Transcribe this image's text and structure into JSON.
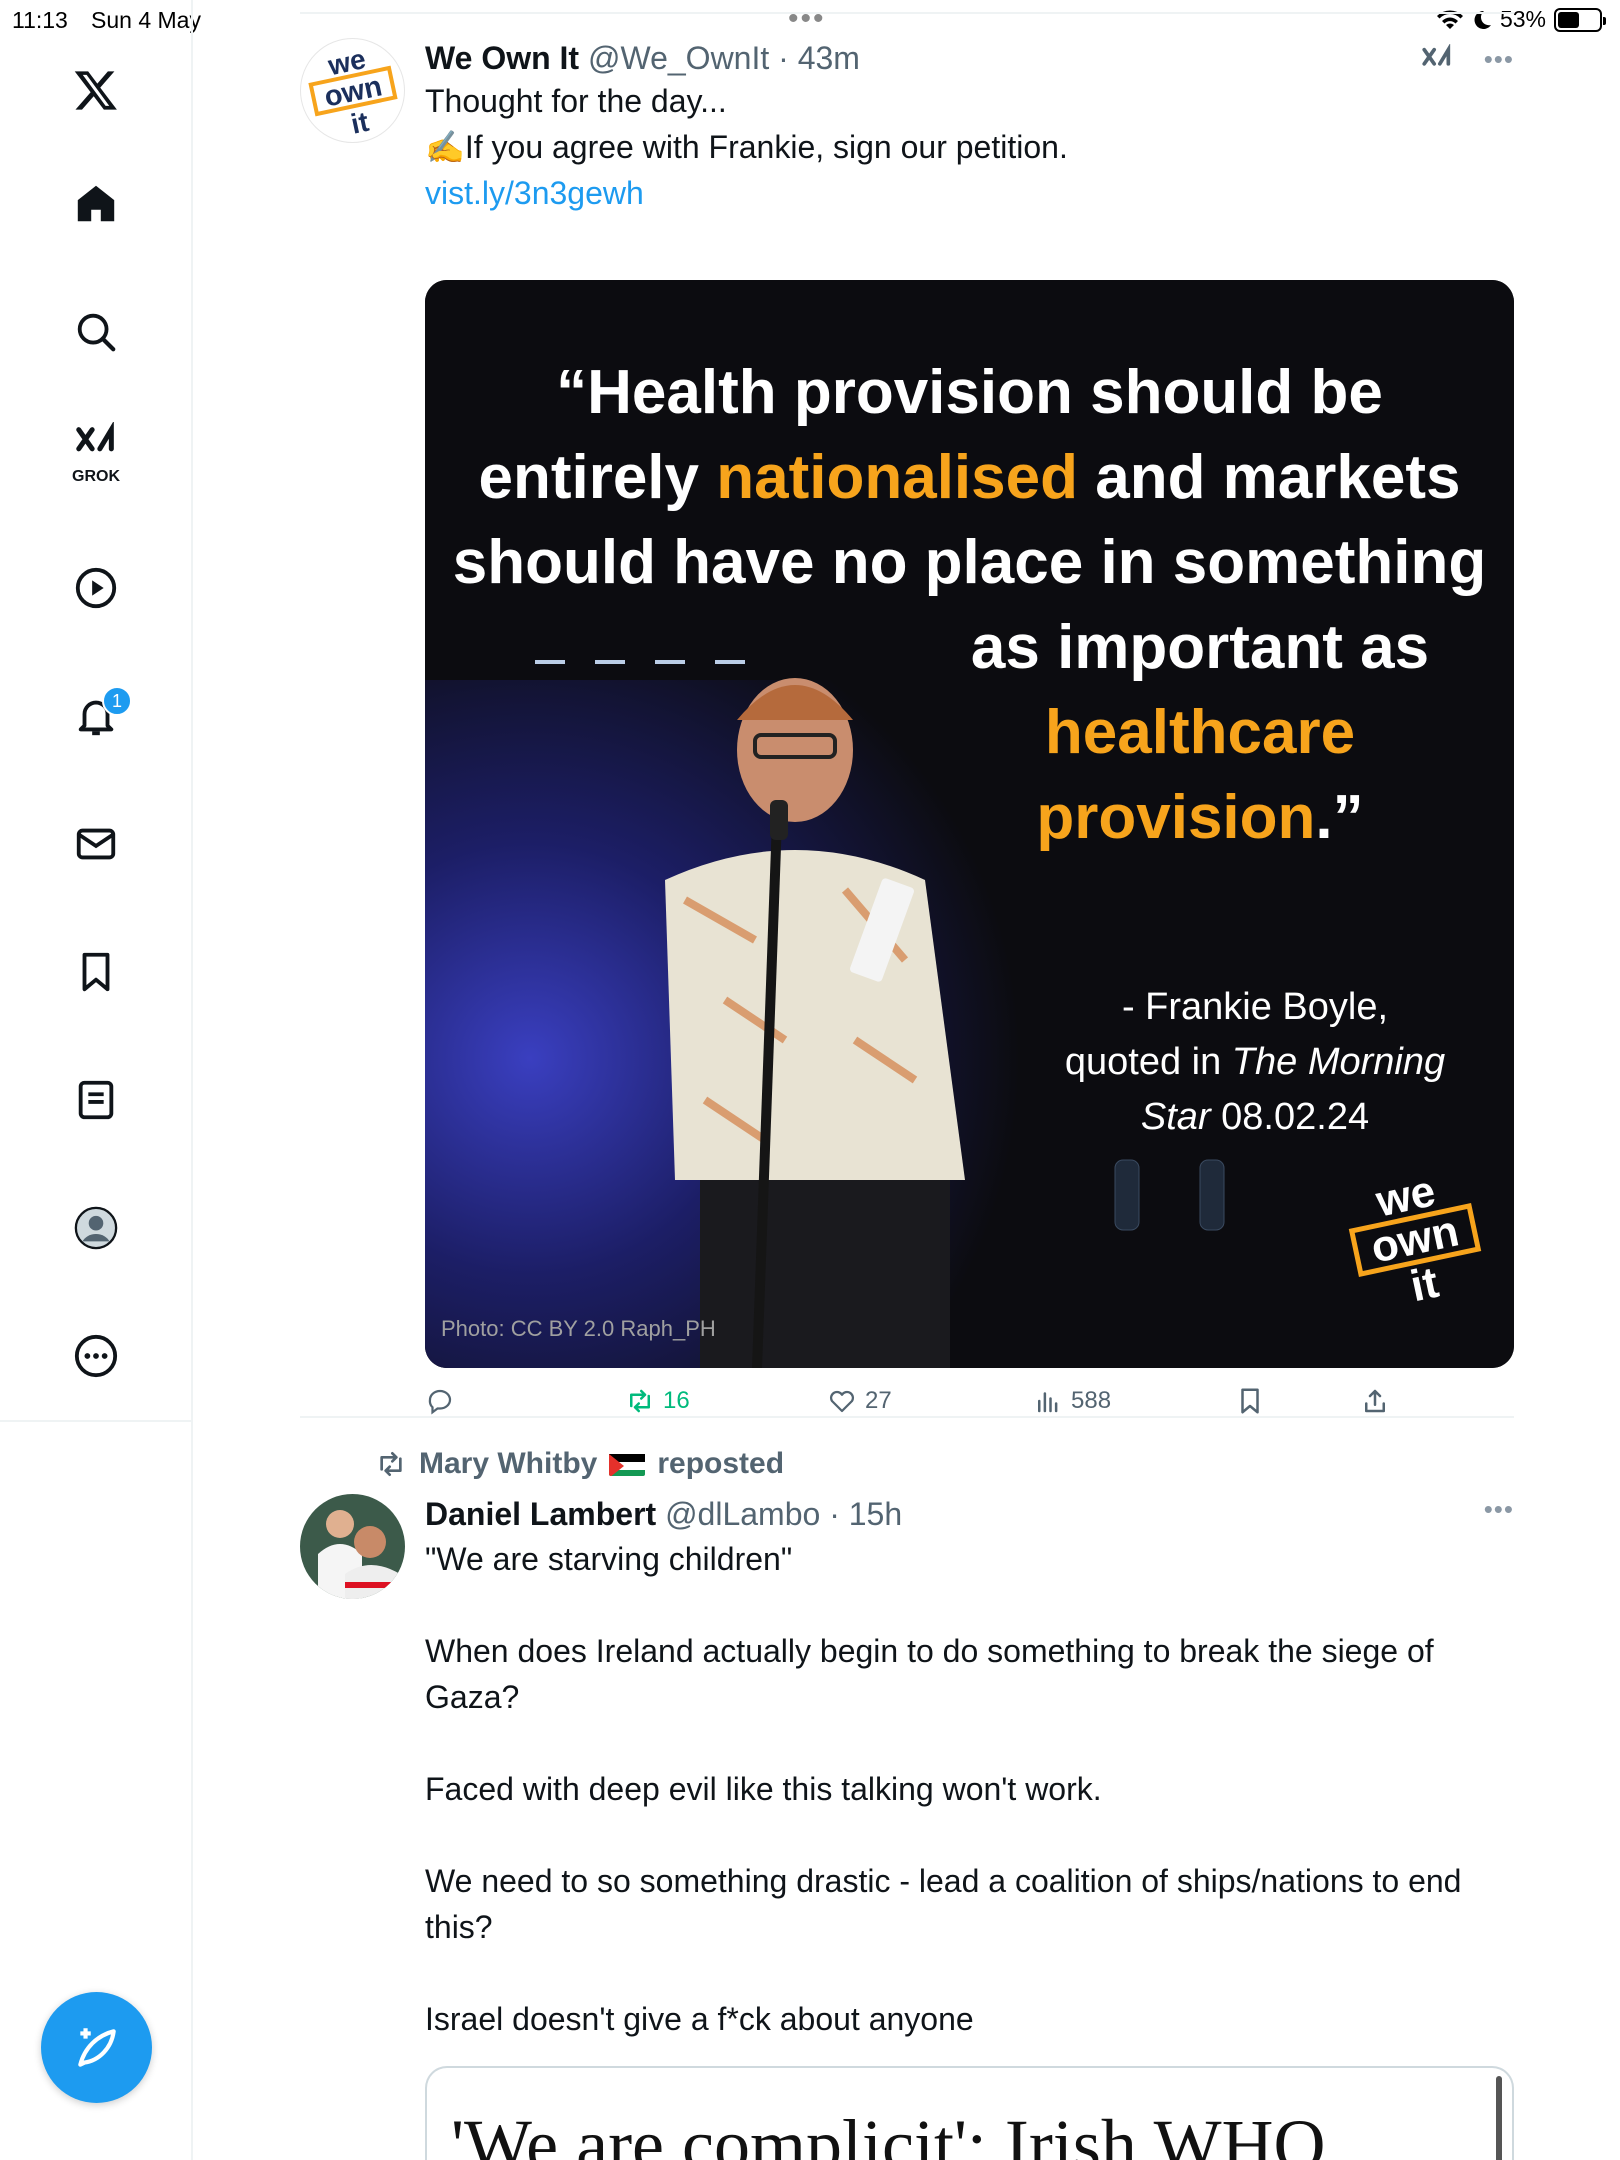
{
  "status_bar": {
    "time": "11:13",
    "date": "Sun 4 May",
    "battery": "53%",
    "battery_level": 0.53
  },
  "sidebar": {
    "items": [
      {
        "name": "x-logo",
        "icon": "x-logo-icon"
      },
      {
        "name": "home",
        "icon": "home-icon"
      },
      {
        "name": "explore",
        "icon": "search-icon"
      },
      {
        "name": "grok",
        "icon": "grok-icon",
        "label": "GROK"
      },
      {
        "name": "video",
        "icon": "play-icon"
      },
      {
        "name": "notifications",
        "icon": "bell-icon",
        "badge": "1"
      },
      {
        "name": "messages",
        "icon": "mail-icon"
      },
      {
        "name": "bookmarks",
        "icon": "bookmark-icon"
      },
      {
        "name": "lists",
        "icon": "list-icon"
      },
      {
        "name": "profile",
        "icon": "avatar-icon"
      },
      {
        "name": "more",
        "icon": "more-icon"
      }
    ],
    "compose_icon": "compose-icon"
  },
  "tweet1": {
    "name": "We Own It",
    "handle": "@We_OwnIt",
    "sep": "·",
    "ago": "43m",
    "lines": [
      "Thought for the day...",
      "✍️If you agree with Frankie, sign our petition."
    ],
    "link": "vist.ly/3n3gewh",
    "media": {
      "quote_parts": [
        {
          "text": "“Health provision should be",
          "highlight": false
        },
        {
          "text": "entirely ",
          "highlight": false
        },
        {
          "text": "nationalised",
          "highlight": true
        },
        {
          "text": " and markets",
          "highlight": false
        },
        {
          "text": "should have no place in something",
          "highlight": false
        },
        {
          "text": "as important as",
          "highlight": false
        },
        {
          "text": "healthcare",
          "highlight": true
        },
        {
          "text": "provision",
          "highlight": true
        },
        {
          "text": ".”",
          "highlight": false
        }
      ],
      "attribution_1": "- Frankie Boyle,",
      "attribution_2a": "quoted in ",
      "attribution_2b": "The Morning",
      "attribution_3a": "Star",
      "attribution_3b": " 08.02.24",
      "credit": "Photo: CC BY 2.0 Raph_PH",
      "logo_lines": [
        "we",
        "own",
        "it"
      ]
    },
    "stats": {
      "reposts": "16",
      "likes": "27",
      "views": "588"
    }
  },
  "tweet2": {
    "repost_by": "Mary Whitby",
    "repost_label": "reposted",
    "name": "Daniel Lambert",
    "handle": "@dlLambo",
    "sep": "·",
    "ago": "15h",
    "paragraphs": [
      "\"We are starving children\"",
      "When does Ireland actually begin to do something to break the siege of Gaza?",
      "Faced with deep evil like this talking won't work.",
      "We need to so something drastic - lead a coalition of ships/nations to end this?",
      "Israel doesn't give a f*ck about anyone"
    ],
    "card_headline": "'We are complicit': Irish WHO"
  },
  "colors": {
    "accent": "#1d9bf0",
    "orange": "#f7a41c",
    "repost_green": "#00ba7c",
    "secondary_text": "#536471"
  }
}
